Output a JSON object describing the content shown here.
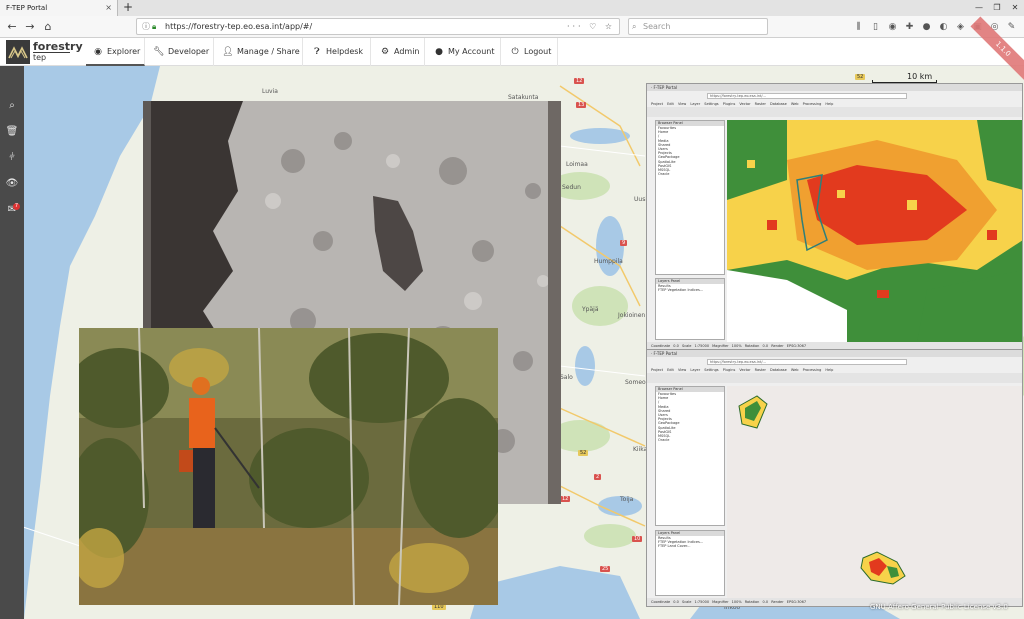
{
  "browser": {
    "tab_title": "F-TEP Portal",
    "tab_close": "×",
    "new_tab": "+",
    "window_controls": [
      "—",
      "❐",
      "✕"
    ],
    "back": "←",
    "forward": "→",
    "home": "⌂",
    "url": "https://forestry-tep.eo.esa.int/app/#/",
    "url_actions": "··· ♡ ☆",
    "search_placeholder": "Search"
  },
  "app": {
    "brand_line1": "forestry",
    "brand_line2": "tep",
    "nav": [
      {
        "label": "Explorer",
        "icon": "compass-icon"
      },
      {
        "label": "Developer",
        "icon": "wrench-icon"
      },
      {
        "label": "Manage / Share",
        "icon": "user-icon"
      },
      {
        "label": "Helpdesk",
        "icon": "question-icon"
      },
      {
        "label": "Admin",
        "icon": "gear-icon"
      },
      {
        "label": "My Account",
        "icon": "account-icon"
      },
      {
        "label": "Logout",
        "icon": "power-icon"
      }
    ],
    "version_ribbon": "1.1.0",
    "sidebar_badge": "7"
  },
  "map": {
    "scale": "10 km",
    "labels": [
      "Luvia",
      "Satakunta",
      "Humppila",
      "Ypäjä",
      "Jokioinen",
      "Someo",
      "Kiikala",
      "Toija",
      "Inkoo",
      "Salo",
      "Loimaa",
      "Sedun",
      "Uusikaupunki"
    ],
    "roads": [
      "12",
      "13",
      "9",
      "52",
      "2",
      "12",
      "10",
      "52",
      "110",
      "40",
      "25"
    ]
  },
  "qgis_top": {
    "title": "· F-TEP Portal",
    "url": "https://forestry-tep.eo.esa.int/...",
    "menu": "Project Edit View Layer Settings Plugins Vector Raster Database Web Processing Help",
    "panel_header": "Browser Panel",
    "tree": [
      "Favourites",
      "Home",
      "/",
      "Media",
      "Shared",
      "Users",
      "Projects",
      "GeoPackage",
      "SpatiaLite",
      "PostGIS",
      "MSSQL",
      "Oracle",
      "DB2",
      "WMS",
      "XYZ Tiles",
      "ArcGIS"
    ],
    "layers_header": "Layers Panel",
    "layers": [
      "Results",
      "FTEP Vegetation Indices..."
    ],
    "status": "Coordinate 0.0 Scale 1:75000 Magnifier 100% Rotation 0.0 Render EPSG:3067"
  },
  "qgis_bottom": {
    "title": "· F-TEP Portal",
    "url": "https://forestry-tep.eo.esa.int/...",
    "menu": "Project Edit View Layer Settings Plugins Vector Raster Database Web Processing Help",
    "panel_header": "Browser Panel",
    "tree": [
      "Favourites",
      "Home",
      "/",
      "Media",
      "Shared",
      "Users",
      "Projects",
      "GeoPackage",
      "SpatiaLite",
      "PostGIS",
      "MSSQL",
      "Oracle",
      "DB2",
      "WMS",
      "XYZ Tiles",
      "ArcGIS"
    ],
    "layers_header": "Layers Panel",
    "layers": [
      "Results",
      "FTEP Vegetation Indices...",
      "FTEP Land Cover..."
    ],
    "status": "Coordinate 0.0 Scale 1:75000 Magnifier 100% Rotation 0.0 Render EPSG:3067"
  },
  "footer": {
    "license": "GNU Affero General Public License v3.0"
  }
}
